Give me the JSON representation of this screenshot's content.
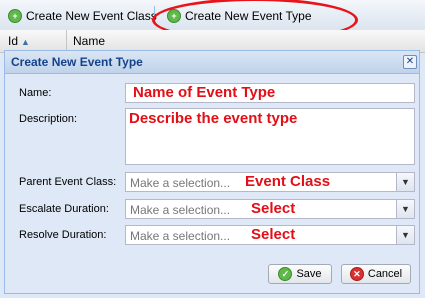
{
  "toolbar": {
    "create_class_label": "Create New Event Class",
    "create_type_label": "Create New Event Type"
  },
  "grid": {
    "columns": [
      "Id",
      "Name"
    ]
  },
  "dialog": {
    "title": "Create New Event Type",
    "close_glyph": "✕",
    "fields": {
      "name_label": "Name:",
      "description_label": "Description:",
      "parent_label": "Parent Event Class:",
      "escalate_label": "Escalate Duration:",
      "resolve_label": "Resolve Duration:",
      "combo_placeholder": "Make a selection..."
    },
    "save_label": "Save",
    "cancel_label": "Cancel"
  },
  "annotations": {
    "name": "Name of Event Type",
    "description": "Describe the event type",
    "parent": "Event Class",
    "escalate": "Select",
    "resolve": "Select"
  },
  "colors": {
    "annotation": "#e20f17",
    "title": "#15428b"
  }
}
